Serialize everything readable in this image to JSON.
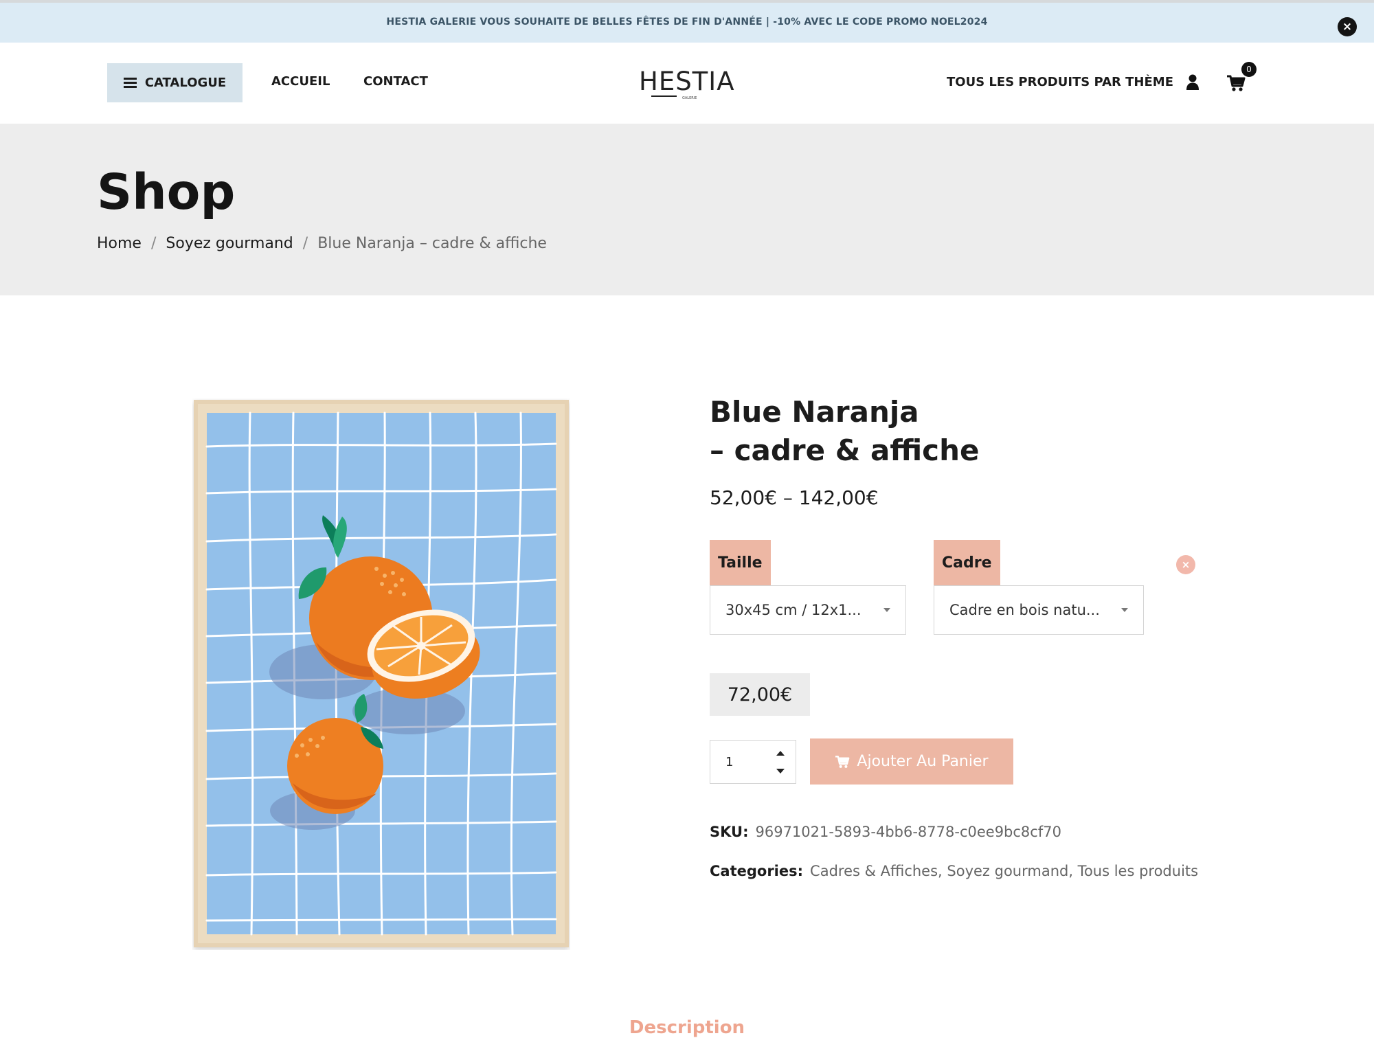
{
  "promo": {
    "text": "HESTIA GALERIE VOUS SOUHAITE DE BELLES FÊTES DE FIN D'ANNÉE | -10% AVEC LE CODE PROMO NOEL2024",
    "close_icon": "close-icon"
  },
  "header": {
    "catalogue_label": "CATALOGUE",
    "nav": [
      "ACCUEIL",
      "CONTACT"
    ],
    "logo": "HESTIA",
    "logo_sub": "GALERIE",
    "theme_link": "TOUS LES PRODUITS PAR THÈME",
    "cart_count": "0",
    "icons": [
      "menu-icon",
      "user-icon",
      "cart-icon"
    ]
  },
  "page": {
    "title": "Shop",
    "breadcrumb": [
      "Home",
      "Soyez gourmand",
      "Blue Naranja – cadre & affiche"
    ]
  },
  "product": {
    "title_line1": "Blue Naranja",
    "title_line2": "– cadre & affiche",
    "price_range": "52,00€ – 142,00€",
    "attributes": [
      {
        "label": "Taille",
        "selected": "30x45 cm / 12x1..."
      },
      {
        "label": "Cadre",
        "selected": "Cadre en bois natu..."
      }
    ],
    "variation_price": "72,00€",
    "quantity": "1",
    "add_to_cart": "Ajouter Au Panier",
    "sku_label": "SKU:",
    "sku": "96971021-5893-4bb6-8778-c0ee9bc8cf70",
    "categories_label": "Categories:",
    "categories": "Cadres & Affiches, Soyez gourmand, Tous les produits"
  },
  "tabs": {
    "description": "Description"
  },
  "colors": {
    "promo_bg": "#dcebf5",
    "accent": "#edb7a4",
    "poster_blue": "#93c0ea",
    "orange": "#ef7d1f"
  }
}
